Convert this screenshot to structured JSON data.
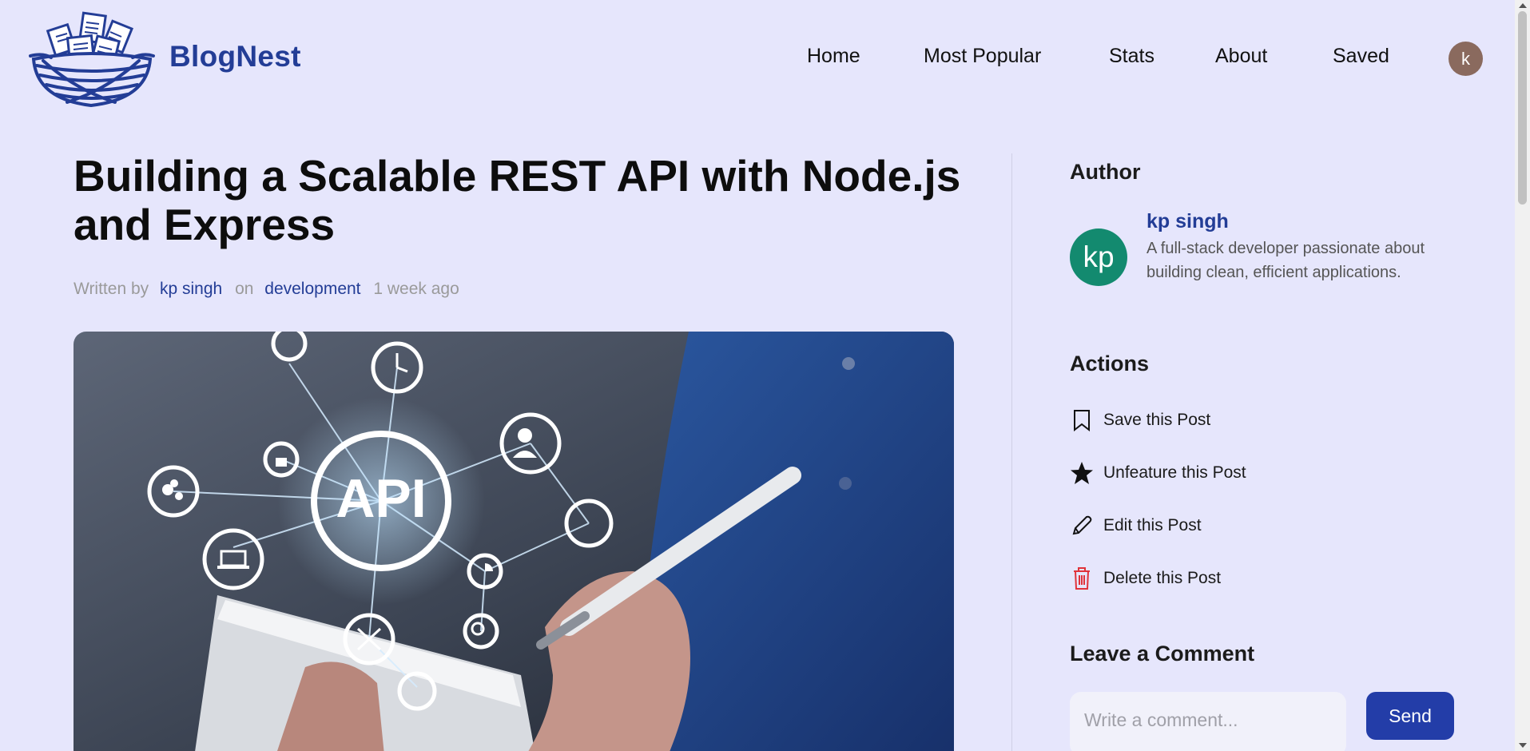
{
  "header": {
    "brand": "BlogNest",
    "nav": [
      "Home",
      "Most Popular",
      "Stats",
      "About",
      "Saved"
    ],
    "user_initial": "k"
  },
  "post": {
    "title": "Building a Scalable REST API with Node.js and Express",
    "meta": {
      "written_by": "Written by",
      "author": "kp singh",
      "on": "on",
      "category": "development",
      "time": "1 week ago"
    },
    "hero_image_text": "API"
  },
  "sidebar": {
    "author_heading": "Author",
    "author_initials": "kp",
    "author_name": "kp singh",
    "author_bio": "A full-stack developer passionate about building clean, efficient applications.",
    "actions_heading": "Actions",
    "actions": [
      {
        "label": "Save this Post",
        "icon": "bookmark-icon"
      },
      {
        "label": "Unfeature this Post",
        "icon": "star-icon"
      },
      {
        "label": "Edit this Post",
        "icon": "pencil-icon"
      },
      {
        "label": "Delete this Post",
        "icon": "trash-icon"
      }
    ],
    "comment_heading": "Leave a Comment",
    "comment_placeholder": "Write a comment...",
    "send_label": "Send"
  },
  "colors": {
    "background": "#e6e6fc",
    "brand": "#233d96",
    "send_button": "#233da8",
    "author_avatar": "#138a6f",
    "user_avatar": "#8a6a5e",
    "delete_icon": "#e0323a"
  }
}
